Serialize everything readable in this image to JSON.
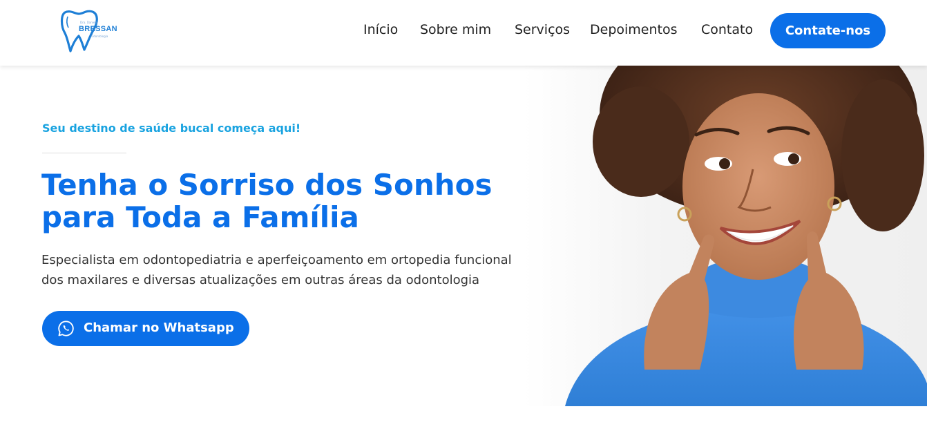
{
  "header": {
    "logo": {
      "small_text": "Dra. Daniela",
      "wordmark": "BRESSAN",
      "sub_text": "Odontologia",
      "icon": "tooth-logo-icon"
    },
    "nav": [
      {
        "label": "Início"
      },
      {
        "label": "Sobre mim"
      },
      {
        "label": "Serviços"
      },
      {
        "label": "Depoimentos"
      },
      {
        "label": "Contato"
      }
    ],
    "cta_label": "Contate-nos"
  },
  "hero": {
    "tagline": "Seu destino de saúde bucal começa aqui!",
    "headline_line1": "Tenha o Sorriso dos Sonhos",
    "headline_line2": "para Toda a Família",
    "description_line1": "Especialista em odontopediatria e aperfeiçoamento em ortopedia funcional",
    "description_line2": "dos maxilares e diversas atualizações em outras áreas da odontologia",
    "whatsapp_button_label": "Chamar no Whatsapp",
    "whatsapp_icon": "whatsapp-icon",
    "image_icon": "smiling-woman-photo"
  },
  "colors": {
    "primary": "#0b6fe8",
    "tagline": "#19a3e0",
    "text": "#222222",
    "sweater": "#3f8fe0",
    "skin": "#c98a66",
    "hair": "#5a3522"
  }
}
